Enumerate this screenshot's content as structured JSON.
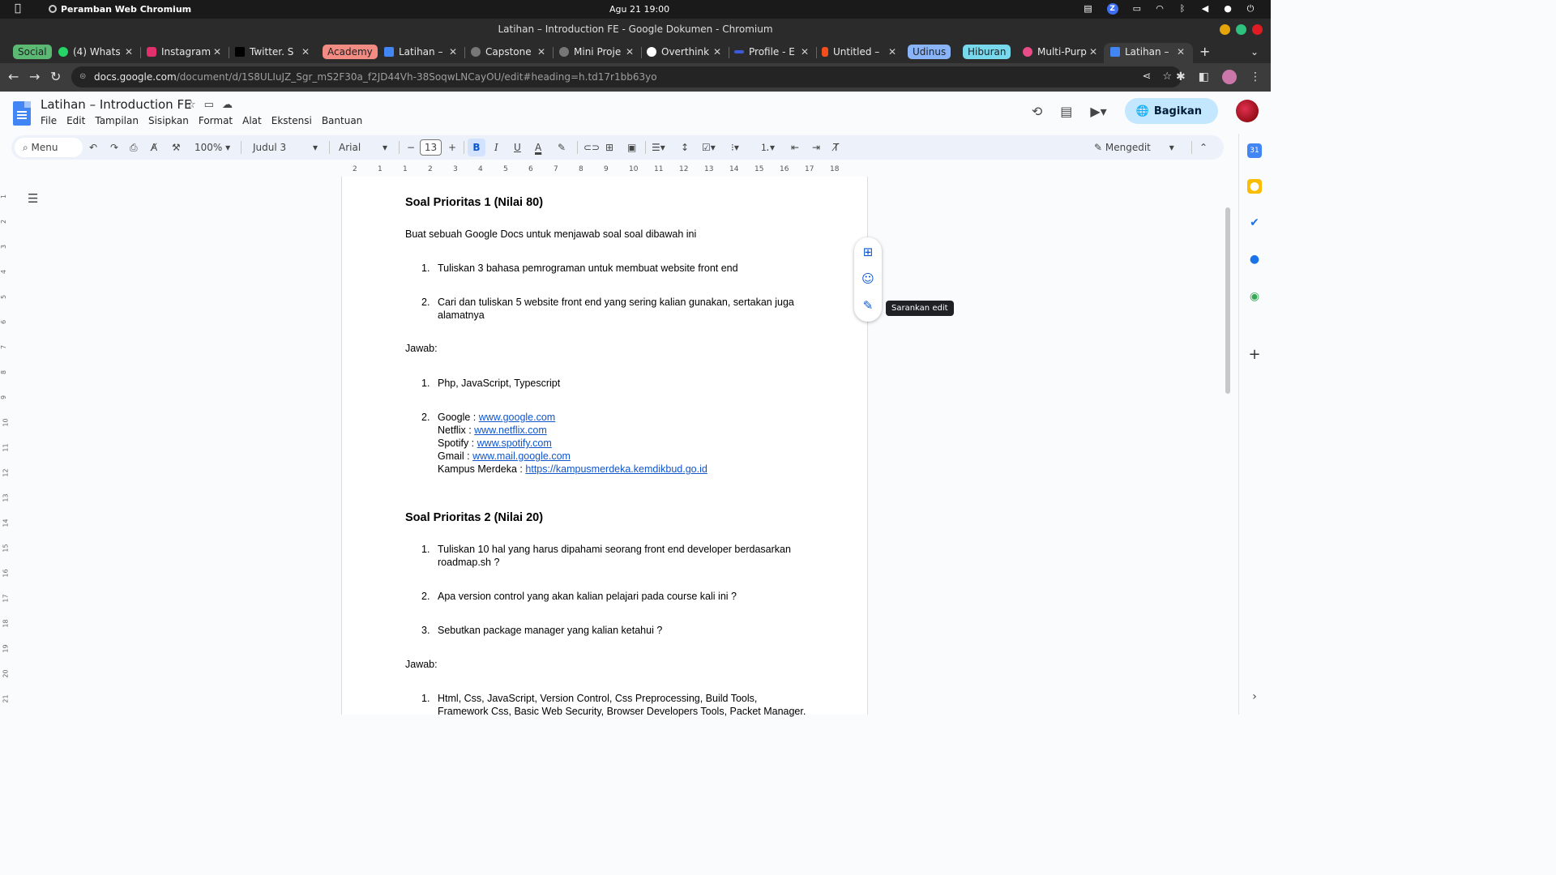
{
  "os": {
    "app_name": "Peramban Web Chromium",
    "clock": "Agu 21  19:00",
    "tray_badge": "Z"
  },
  "window": {
    "title": "Latihan – Introduction FE - Google Dokumen - Chromium"
  },
  "tabs": [
    {
      "label": "Social",
      "kind": "group",
      "color": "#5bb974"
    },
    {
      "label": "(4) Whats",
      "kind": "tab"
    },
    {
      "label": "Instagram",
      "kind": "tab"
    },
    {
      "label": "Twitter. S",
      "kind": "tab"
    },
    {
      "label": "Academy",
      "kind": "group",
      "color": "#f28b82"
    },
    {
      "label": "Latihan –",
      "kind": "tab"
    },
    {
      "label": "Capstone",
      "kind": "tab"
    },
    {
      "label": "Mini Proje",
      "kind": "tab"
    },
    {
      "label": "Overthink",
      "kind": "tab"
    },
    {
      "label": "Profile - E",
      "kind": "tab"
    },
    {
      "label": "Untitled –",
      "kind": "tab"
    },
    {
      "label": "Udinus",
      "kind": "group",
      "color": "#8ab4f8"
    },
    {
      "label": "Hiburan",
      "kind": "group",
      "color": "#78d9ec"
    },
    {
      "label": "Multi-Purp",
      "kind": "tab"
    },
    {
      "label": "Latihan –",
      "kind": "active"
    }
  ],
  "address": {
    "host": "docs.google.com",
    "path": "/document/d/1S8ULIuJZ_Sgr_mS2F30a_f2JD44Vh-38SoqwLNCayOU/edit#heading=h.td17r1bb63yo"
  },
  "doc": {
    "title": "Latihan – Introduction FE",
    "menu": [
      "File",
      "Edit",
      "Tampilan",
      "Sisipkan",
      "Format",
      "Alat",
      "Ekstensi",
      "Bantuan"
    ],
    "share_label": "Bagikan"
  },
  "toolbar": {
    "menu_search": "Menu",
    "zoom": "100%",
    "style": "Judul 3",
    "font": "Arial",
    "font_size": "13",
    "mode": "Mengedit"
  },
  "ruler_labels": [
    "2",
    "1",
    "1",
    "2",
    "3",
    "4",
    "5",
    "6",
    "7",
    "8",
    "9",
    "10",
    "11",
    "12",
    "13",
    "14",
    "15",
    "16",
    "17",
    "18"
  ],
  "vruler_labels": [
    "1",
    "2",
    "3",
    "4",
    "5",
    "6",
    "7",
    "8",
    "9",
    "10",
    "11",
    "12",
    "13",
    "14",
    "15",
    "16",
    "17",
    "18",
    "19",
    "20",
    "21"
  ],
  "content": {
    "h1": "Soal Prioritas 1 (Nilai 80)",
    "intro": "Buat sebuah Google Docs untuk menjawab soal soal dibawah ini",
    "q1": [
      {
        "num": "1.",
        "text": "Tuliskan 3 bahasa pemrograman untuk membuat website front end"
      },
      {
        "num": "2.",
        "text": "Cari dan tuliskan 5 website front end yang sering kalian gunakan, sertakan juga alamatnya"
      }
    ],
    "jawab1": "Jawab:",
    "a1_1": {
      "num": "1.",
      "text": "Php, JavaScript, Typescript"
    },
    "a1_2_num": "2.",
    "sites": [
      {
        "name": "Google : ",
        "url": "www.google.com"
      },
      {
        "name": "Netflix : ",
        "url": "www.netflix.com"
      },
      {
        "name": "Spotify : ",
        "url": "www.spotify.com"
      },
      {
        "name": "Gmail : ",
        "url": "www.mail.google.com"
      },
      {
        "name": "Kampus Merdeka : ",
        "url": "https://kampusmerdeka.kemdikbud.go.id"
      }
    ],
    "h2": "Soal Prioritas 2 (Nilai 20)",
    "q2": [
      {
        "num": "1.",
        "text": "Tuliskan 10 hal yang harus dipahami seorang front end developer berdasarkan roadmap.sh ?"
      },
      {
        "num": "2.",
        "text": "Apa version control yang akan kalian pelajari pada course kali ini ?"
      },
      {
        "num": "3.",
        "text": "Sebutkan package manager yang kalian ketahui ?"
      }
    ],
    "jawab2": "Jawab:",
    "a2_1": {
      "num": "1.",
      "text": " Html, Css, JavaScript, Version Control, Css Preprocessing, Build Tools, Framework Css, Basic Web Security, Browser Developers Tools, Packet Manager."
    }
  },
  "tooltip": "Sarankan edit"
}
